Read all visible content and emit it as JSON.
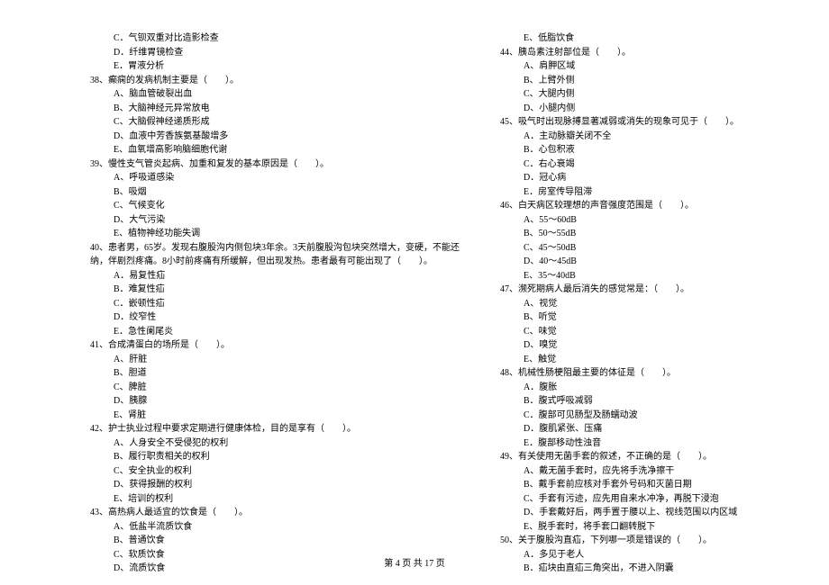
{
  "left_column": {
    "pre_options": [
      "C．气钡双重对比造影检查",
      "D．纤维胃镜检查",
      "E．胃液分析"
    ],
    "q38": {
      "stem": "38、癫痫的发病机制主要是（　　）。",
      "options": [
        "A、脑血管破裂出血",
        "B、大脑神经元异常放电",
        "C、大脑假神经递质形成",
        "D、血液中芳香族氨基酸增多",
        "E、血氧增高影响脑细胞代谢"
      ]
    },
    "q39": {
      "stem": "39、慢性支气管炎起病、加重和复发的基本原因是（　　）。",
      "options": [
        "A、呼吸道感染",
        "B、吸烟",
        "C、气候变化",
        "D、大气污染",
        "E、植物神经功能失调"
      ]
    },
    "q40": {
      "stem_lines": [
        "40、患者男，65岁。发现右腹股沟内侧包块3年余。3天前腹股沟包块突然增大，变硬，不能还",
        "纳，伴剧烈疼痛。8小时前疼痛有所缓解，但出现发热。患者最有可能出现了（　　）。"
      ],
      "options": [
        "A．易复性疝",
        "B．难复性疝",
        "C．嵌顿性疝",
        "D．绞窄性",
        "E．急性阑尾炎"
      ]
    },
    "q41": {
      "stem": "41、合成清蛋白的场所是（　　）。",
      "options": [
        "A、肝脏",
        "B、胆道",
        "C、脾脏",
        "D、胰腺",
        "E、肾脏"
      ]
    },
    "q42": {
      "stem": "42、护士执业过程中要求定期进行健康体检，目的是享有（　　）。",
      "options": [
        "A、人身安全不受侵犯的权利",
        "B、履行职责相关的权利",
        "C、安全执业的权利",
        "D、获得报酬的权利",
        "E、培训的权利"
      ]
    },
    "q43": {
      "stem": "43、高热病人最适宜的饮食是（　　）。",
      "options": [
        "A、低盐半流质饮食",
        "B、普通饮食",
        "C、软质饮食",
        "D、流质饮食"
      ]
    }
  },
  "right_column": {
    "pre_options": [
      "E、低脂饮食"
    ],
    "q44": {
      "stem": "44、胰岛素注射部位是（　　）。",
      "options": [
        "A、肩胛区域",
        "B、上臂外侧",
        "C、大腿内侧",
        "D、小腿内侧"
      ]
    },
    "q45": {
      "stem": "45、吸气时出现脉搏显著减弱或消失的现象可见于（　　）。",
      "options": [
        "A．主动脉瓣关闭不全",
        "B．心包积液",
        "C．右心衰竭",
        "D．冠心病",
        "E．房室传导阻滞"
      ]
    },
    "q46": {
      "stem": "46、白天病区较理想的声音强度范围是（　　）。",
      "options": [
        "A、55～60dB",
        "B、50～55dB",
        "C、45～50dB",
        "D、40～45dB",
        "E、35～40dB"
      ]
    },
    "q47": {
      "stem": "47、濒死期病人最后消失的感觉常是：（　　）。",
      "options": [
        "A、视觉",
        "B、听觉",
        "C、味觉",
        "D、嗅觉",
        "E、触觉"
      ]
    },
    "q48": {
      "stem": "48、机械性肠梗阻最主要的体征是（　　）。",
      "options": [
        "A．腹胀",
        "B．腹式呼吸减弱",
        "C．腹部可见肠型及肠蠕动波",
        "D．腹肌紧张、压痛",
        "E．腹部移动性浊音"
      ]
    },
    "q49": {
      "stem": "49、有关使用无菌手套的叙述，不正确的是（　　）。",
      "options": [
        "A、戴无菌手套时，应先将手洗净擦干",
        "B、戴手套前应核对手套外号码和灭菌日期",
        "C、手套有污迹，应先用自来水冲净，再脱下浸泡",
        "D、手套戴好后，两手置于腰以上、视线范围以内区域",
        "E、脱手套时，将手套口翻转脱下"
      ]
    },
    "q50": {
      "stem": "50、关于腹股沟直疝，下列哪一项是错误的（　　）。",
      "options": [
        "A．多见于老人",
        "B．疝块由直疝三角突出，不进入阴囊"
      ]
    }
  },
  "footer": "第 4 页 共 17 页"
}
